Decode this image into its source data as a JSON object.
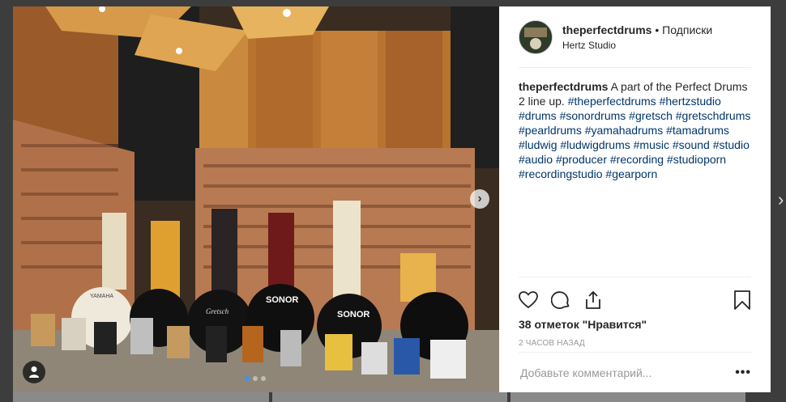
{
  "post": {
    "username": "theperfectdrums",
    "follow_label": "• Подписки",
    "location": "Hertz Studio",
    "caption_user": "theperfectdrums",
    "caption_text": "A part of the Perfect Drums 2 line up.",
    "hashtags": [
      "#theperfectdrums",
      "#hertzstudio",
      "#drums",
      "#sonordrums",
      "#gretsch",
      "#gretschdrums",
      "#pearldrums",
      "#yamahadrums",
      "#tamadrums",
      "#ludwig",
      "#ludwigdrums",
      "#music",
      "#sound",
      "#studio",
      "#audio",
      "#producer",
      "#recording",
      "#studioporn",
      "#recordingstudio",
      "#gearporn"
    ],
    "likes": "38 отметок \"Нравится\"",
    "time_ago": "2 часов назад",
    "comment_placeholder": "Добавьте комментарий...",
    "more_label": "•••"
  },
  "media": {
    "next_arrow": "›",
    "drum_brand_1": "SONOR",
    "drum_brand_2": "SONOR",
    "drum_brand_3": "Gretsch",
    "drum_brand_4": "YAMAHA"
  },
  "nav": {
    "page_next": "›"
  },
  "icons": [
    "heart-icon",
    "comment-icon",
    "share-icon",
    "bookmark-icon",
    "user-tag-icon",
    "chevron-right-icon"
  ]
}
